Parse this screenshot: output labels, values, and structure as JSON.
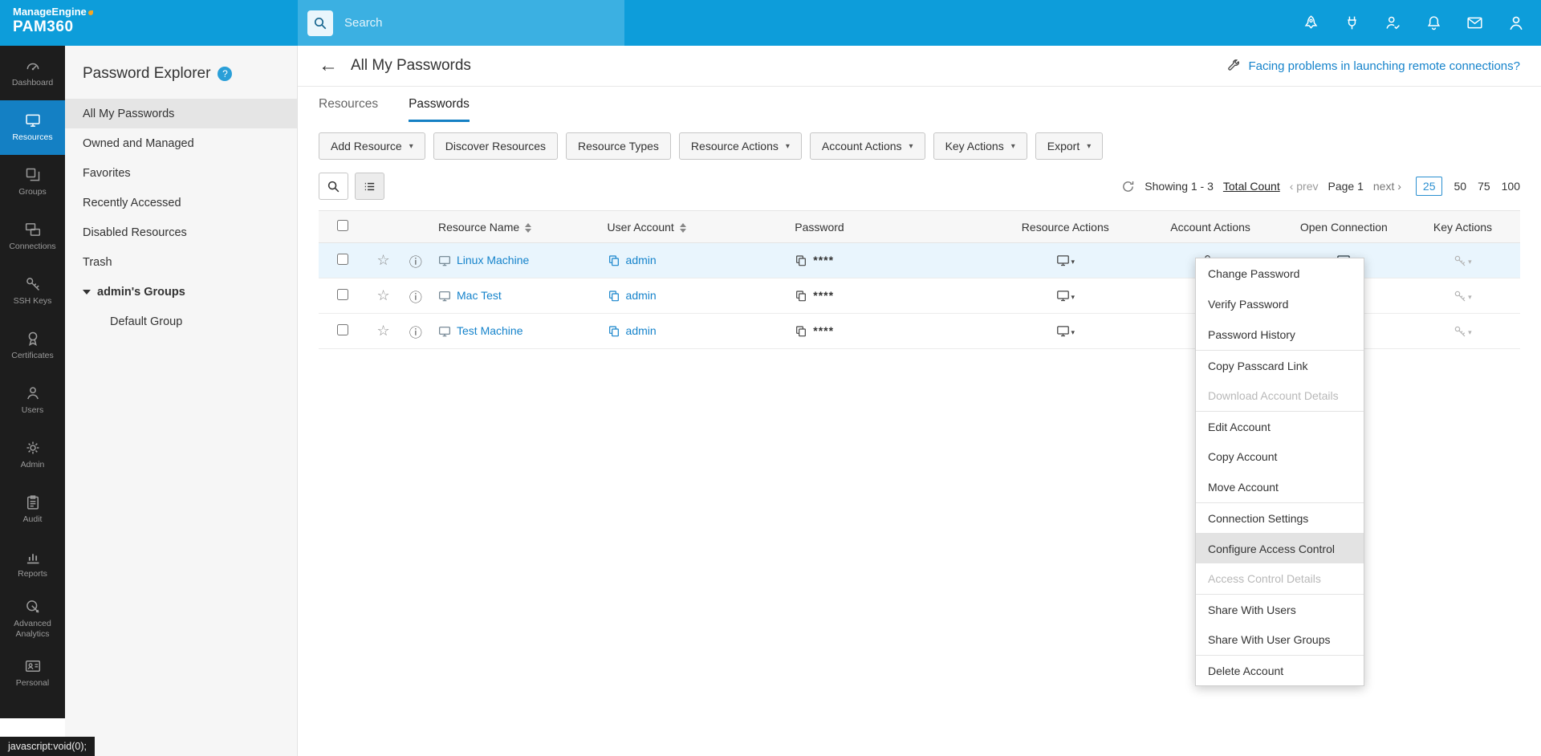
{
  "colors": {
    "accent": "#1583cb",
    "topbar": "#0d9dda",
    "selected_row": "#e9f5fd",
    "sidebar_active": "#1480c4"
  },
  "glyphs": {
    "star": "☆",
    "info": "ⓘ",
    "caret": "▾",
    "back": "←",
    "question": "?"
  },
  "topbar": {
    "brand_line1": "ManageEngine",
    "brand_line2": "PAM360",
    "search_placeholder": "Search"
  },
  "sidebar": {
    "items": [
      {
        "label": "Dashboard"
      },
      {
        "label": "Resources"
      },
      {
        "label": "Groups"
      },
      {
        "label": "Connections"
      },
      {
        "label": "SSH Keys"
      },
      {
        "label": "Certificates"
      },
      {
        "label": "Users"
      },
      {
        "label": "Admin"
      },
      {
        "label": "Audit"
      },
      {
        "label": "Reports"
      },
      {
        "label": "Advanced Analytics"
      },
      {
        "label": "Personal"
      }
    ]
  },
  "explorer": {
    "title": "Password Explorer",
    "items": [
      {
        "label": "All My Passwords"
      },
      {
        "label": "Owned and Managed"
      },
      {
        "label": "Favorites"
      },
      {
        "label": "Recently Accessed"
      },
      {
        "label": "Disabled Resources"
      },
      {
        "label": "Trash"
      },
      {
        "label": "admin's Groups"
      },
      {
        "label": "Default Group"
      }
    ]
  },
  "main": {
    "page_title": "All My Passwords",
    "help_link": "Facing problems in launching remote connections?",
    "tabs": [
      {
        "label": "Resources"
      },
      {
        "label": "Passwords"
      }
    ],
    "toolbar": [
      {
        "label": "Add Resource"
      },
      {
        "label": "Discover Resources"
      },
      {
        "label": "Resource Types"
      },
      {
        "label": "Resource Actions"
      },
      {
        "label": "Account Actions"
      },
      {
        "label": "Key Actions"
      },
      {
        "label": "Export"
      }
    ],
    "pagination": {
      "showing_label": "Showing 1 - 3",
      "total_count_label": "Total Count",
      "prev_label": "‹ prev",
      "page_label": "Page 1",
      "next_label": "next ›",
      "sizes": [
        "25",
        "50",
        "75",
        "100"
      ]
    },
    "table": {
      "columns": [
        "Resource Name",
        "User Account",
        "Password",
        "Resource Actions",
        "Account Actions",
        "Open Connection",
        "Key Actions"
      ],
      "rows": [
        {
          "resource": "Linux Machine",
          "account": "admin",
          "password": "****"
        },
        {
          "resource": "Mac Test",
          "account": "admin",
          "password": "****"
        },
        {
          "resource": "Test Machine",
          "account": "admin",
          "password": "****"
        }
      ]
    }
  },
  "context_menu": {
    "items": [
      {
        "label": "Change Password"
      },
      {
        "label": "Verify Password"
      },
      {
        "label": "Password History"
      },
      {
        "label": "Copy Passcard Link"
      },
      {
        "label": "Download Account Details"
      },
      {
        "label": "Edit Account"
      },
      {
        "label": "Copy Account"
      },
      {
        "label": "Move Account"
      },
      {
        "label": "Connection Settings"
      },
      {
        "label": "Configure Access Control"
      },
      {
        "label": "Access Control Details"
      },
      {
        "label": "Share With Users"
      },
      {
        "label": "Share With User Groups"
      },
      {
        "label": "Delete Account"
      }
    ]
  },
  "statusbar": {
    "text": "javascript:void(0);"
  }
}
